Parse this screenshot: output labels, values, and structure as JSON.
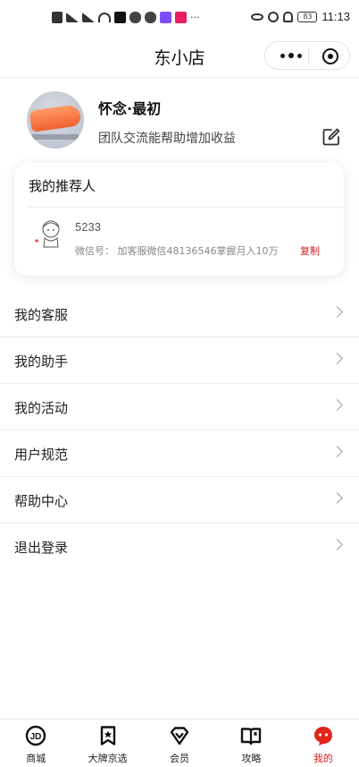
{
  "status_bar": {
    "time": "11:13",
    "battery": "83",
    "more": "···"
  },
  "header": {
    "title": "东小店"
  },
  "profile": {
    "username": "怀念·最初",
    "subtitle": "团队交流能帮助增加收益"
  },
  "referrer": {
    "title": "我的推荐人",
    "name": "5233",
    "wechat": "微信号： 加客服微信48136546掌握月入10万",
    "copy_label": "复制"
  },
  "menu": {
    "items": [
      {
        "label": "我的客服"
      },
      {
        "label": "我的助手"
      },
      {
        "label": "我的活动"
      },
      {
        "label": "用户规范"
      },
      {
        "label": "帮助中心"
      },
      {
        "label": "退出登录"
      }
    ]
  },
  "tabbar": {
    "tabs": [
      {
        "label": "商城",
        "icon": "jd-logo-icon"
      },
      {
        "label": "大牌京选",
        "icon": "bookmark-star-icon"
      },
      {
        "label": "会员",
        "icon": "diamond-icon"
      },
      {
        "label": "攻略",
        "icon": "open-book-icon"
      },
      {
        "label": "我的",
        "icon": "profile-face-icon"
      }
    ],
    "active_color": "#d81e22"
  }
}
